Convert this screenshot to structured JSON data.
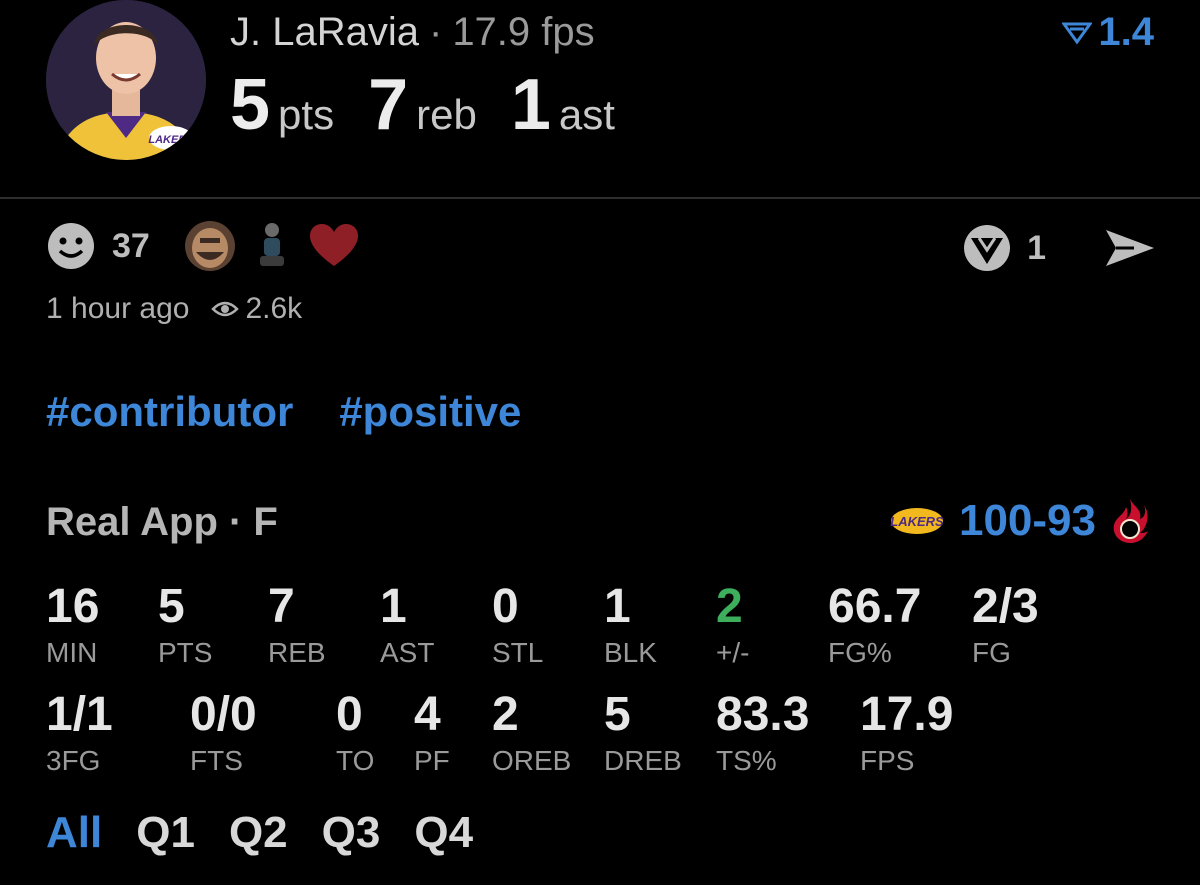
{
  "header": {
    "player_name": "J. LaRavia",
    "separator": "·",
    "fps_text": "17.9 fps",
    "rating": "1.4",
    "stats": [
      {
        "value": "5",
        "unit": "pts"
      },
      {
        "value": "7",
        "unit": "reb"
      },
      {
        "value": "1",
        "unit": "ast"
      }
    ]
  },
  "reactions": {
    "count": "37",
    "right_count": "1"
  },
  "meta": {
    "time_ago": "1 hour ago",
    "views": "2.6k"
  },
  "tags": [
    "#contributor",
    "#positive"
  ],
  "game": {
    "label": "Real App · F",
    "home_score": "100",
    "dash": "-",
    "away_score": "93",
    "home_logo_text": "LAKERS"
  },
  "stats_row1": [
    {
      "value": "16",
      "label": "MIN"
    },
    {
      "value": "5",
      "label": "PTS"
    },
    {
      "value": "7",
      "label": "REB"
    },
    {
      "value": "1",
      "label": "AST"
    },
    {
      "value": "0",
      "label": "STL"
    },
    {
      "value": "1",
      "label": "BLK"
    },
    {
      "value": "2",
      "label": "+/-"
    },
    {
      "value": "66.7",
      "label": "FG%"
    },
    {
      "value": "2/3",
      "label": "FG"
    }
  ],
  "stats_row2": [
    {
      "value": "1/1",
      "label": "3FG"
    },
    {
      "value": "0/0",
      "label": "FTS"
    },
    {
      "value": "0",
      "label": "TO"
    },
    {
      "value": "4",
      "label": "PF"
    },
    {
      "value": "2",
      "label": "OREB"
    },
    {
      "value": "5",
      "label": "DREB"
    },
    {
      "value": "83.3",
      "label": "TS%"
    },
    {
      "value": "17.9",
      "label": "FPS"
    }
  ],
  "quarter_tabs": [
    "All",
    "Q1",
    "Q2",
    "Q3",
    "Q4"
  ],
  "colors": {
    "accent": "#3d86d8",
    "positive": "#3cae5c",
    "lakers_gold": "#f2b91e",
    "heart": "#8e1f26"
  }
}
